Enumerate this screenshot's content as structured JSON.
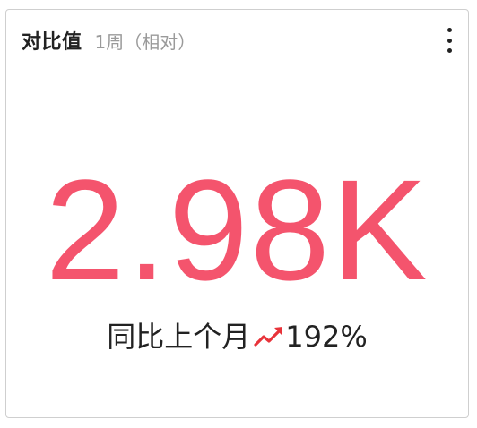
{
  "card": {
    "title": "对比值",
    "subtitle": "1周（相对）",
    "value": "2.98K",
    "comparison_label": "同比上个月",
    "change": "192%",
    "trend_icon": "trend-up-icon",
    "value_color": "#f4546d",
    "trend_color": "#e8333a"
  }
}
